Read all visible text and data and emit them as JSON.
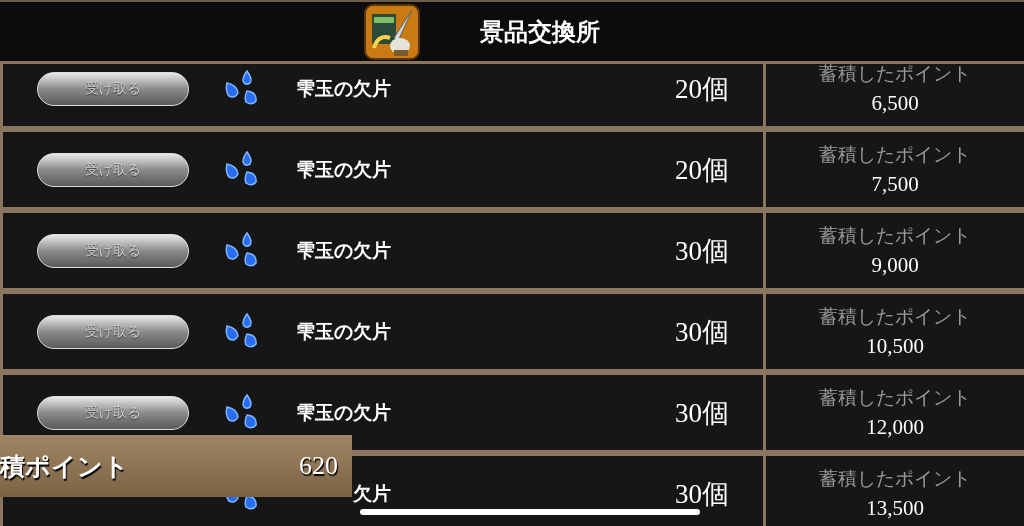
{
  "header": {
    "title": "景品交換所"
  },
  "rows": [
    {
      "button_label": "受け取る",
      "name": "雫玉の欠片",
      "count": "20個",
      "points_label": "蓄積したポイント",
      "points": "6,500"
    },
    {
      "button_label": "受け取る",
      "name": "雫玉の欠片",
      "count": "20個",
      "points_label": "蓄積したポイント",
      "points": "7,500"
    },
    {
      "button_label": "受け取る",
      "name": "雫玉の欠片",
      "count": "30個",
      "points_label": "蓄積したポイント",
      "points": "9,000"
    },
    {
      "button_label": "受け取る",
      "name": "雫玉の欠片",
      "count": "30個",
      "points_label": "蓄積したポイント",
      "points": "10,500"
    },
    {
      "button_label": "受け取る",
      "name": "雫玉の欠片",
      "count": "30個",
      "points_label": "蓄積したポイント",
      "points": "12,000"
    },
    {
      "name": "欠片",
      "count": "30個",
      "points_label": "蓄積したポイント",
      "points": "13,500"
    }
  ],
  "points_panel": {
    "label": "積ポイント",
    "value": "620"
  }
}
